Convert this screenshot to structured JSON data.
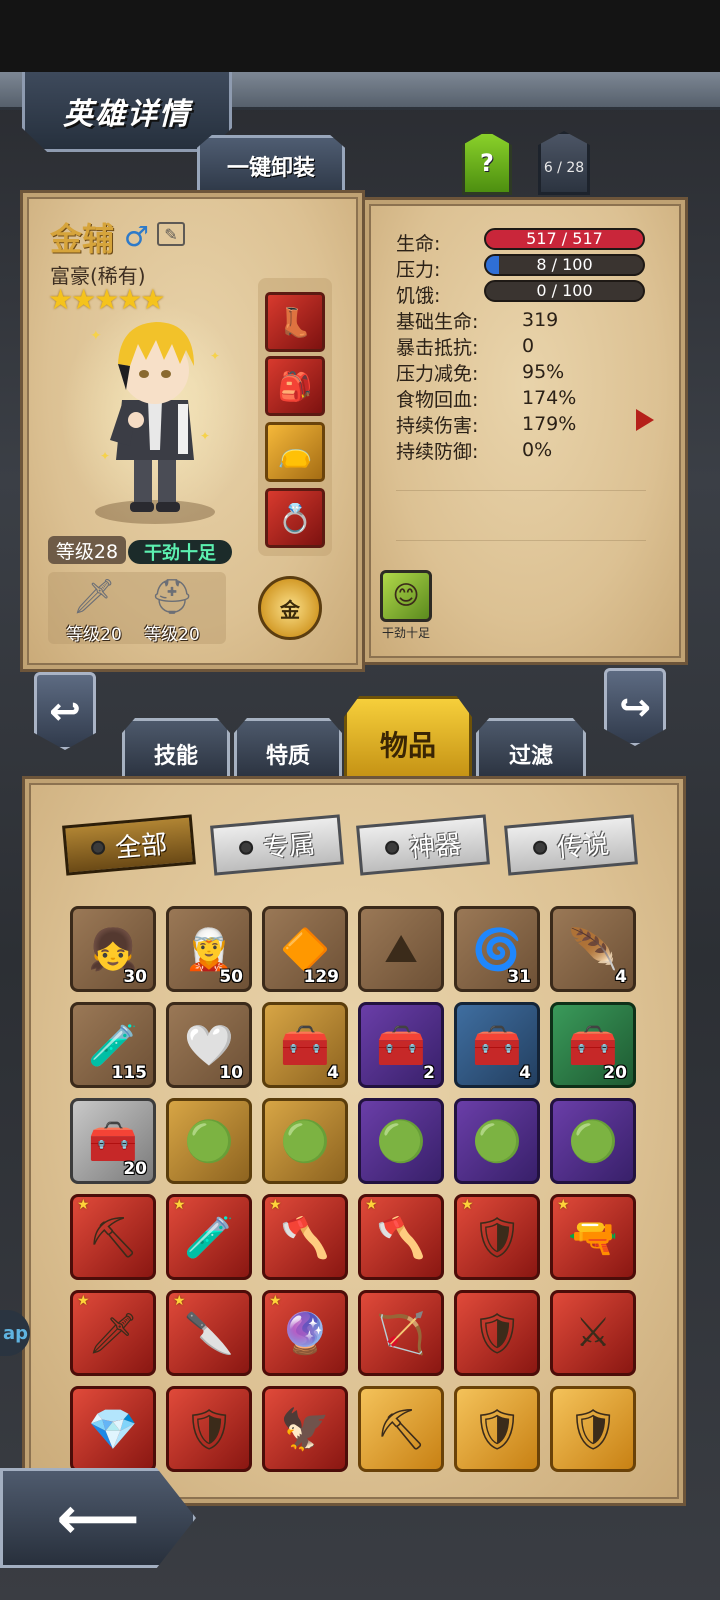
{
  "header": {
    "title": "英雄详情",
    "unequip_label": "一键卸装",
    "help_label": "?",
    "hero_index": "6 / 28"
  },
  "hero": {
    "name": "金辅",
    "class": "富豪(稀有)",
    "stars": "★★★★★",
    "level": "等级28",
    "mood": "干劲十足",
    "weapon_level": "等级20",
    "armor_level": "等级20",
    "coin_label": "金"
  },
  "stats": {
    "hp_label": "生命:",
    "hp_value": "517 / 517",
    "hp_fill": 1.0,
    "stress_label": "压力:",
    "stress_value": "8 / 100",
    "stress_fill": 0.08,
    "hunger_label": "饥饿:",
    "hunger_value": "0 / 100",
    "hunger_fill": 0.0,
    "rows": [
      {
        "label": "基础生命:",
        "value": "319"
      },
      {
        "label": "暴击抵抗:",
        "value": "0"
      },
      {
        "label": "压力减免:",
        "value": "95%"
      },
      {
        "label": "食物回血:",
        "value": "174%"
      },
      {
        "label": "持续伤害:",
        "value": "179%"
      },
      {
        "label": "持续防御:",
        "value": "0%"
      }
    ],
    "trait_label": "干劲十足"
  },
  "tabs": {
    "skills": "技能",
    "traits": "特质",
    "items": "物品",
    "filter": "过滤"
  },
  "filters": {
    "all": "全部",
    "exclusive": "专属",
    "artifact": "神器",
    "legend": "传说"
  },
  "items": [
    {
      "icon": "👧",
      "count": "30"
    },
    {
      "icon": "🧝",
      "count": "50"
    },
    {
      "icon": "🔶",
      "count": "129"
    },
    {
      "icon": "⛰",
      "count": ""
    },
    {
      "icon": "🌀",
      "count": "31"
    },
    {
      "icon": "🪶",
      "count": "4"
    },
    {
      "icon": "🧪",
      "count": "115"
    },
    {
      "icon": "🤍",
      "count": "10"
    },
    {
      "icon": "🧰",
      "count": "4"
    },
    {
      "icon": "🧰",
      "count": "2"
    },
    {
      "icon": "🧰",
      "count": "4"
    },
    {
      "icon": "🧰",
      "count": "20"
    },
    {
      "icon": "🧰",
      "count": "20"
    },
    {
      "icon": "🟢",
      "count": ""
    },
    {
      "icon": "🟢",
      "count": ""
    },
    {
      "icon": "🟢",
      "count": ""
    },
    {
      "icon": "🟢",
      "count": ""
    },
    {
      "icon": "🟢",
      "count": ""
    },
    {
      "icon": "⛏",
      "count": ""
    },
    {
      "icon": "🧪",
      "count": ""
    },
    {
      "icon": "🪓",
      "count": ""
    },
    {
      "icon": "🪓",
      "count": ""
    },
    {
      "icon": "🛡",
      "count": ""
    },
    {
      "icon": "🔫",
      "count": ""
    },
    {
      "icon": "🗡",
      "count": ""
    },
    {
      "icon": "🔪",
      "count": ""
    },
    {
      "icon": "🔮",
      "count": ""
    },
    {
      "icon": "🏹",
      "count": ""
    },
    {
      "icon": "🛡",
      "count": ""
    },
    {
      "icon": "⚔",
      "count": ""
    },
    {
      "icon": "💎",
      "count": ""
    },
    {
      "icon": "🛡",
      "count": ""
    },
    {
      "icon": "🦅",
      "count": ""
    },
    {
      "icon": "⛏",
      "count": ""
    },
    {
      "icon": "🛡",
      "count": ""
    },
    {
      "icon": "🛡",
      "count": ""
    }
  ],
  "side_tab": "ap",
  "colors": {
    "hp": "#c9263a",
    "stress": "#2f6fd6",
    "hunger": "#4a4a4a",
    "active_tab": "#f6cf3b"
  }
}
